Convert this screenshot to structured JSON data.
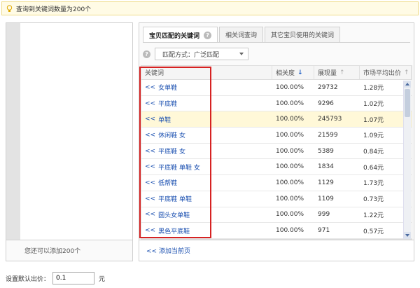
{
  "notice": {
    "text": "查询到关键词数量为200个"
  },
  "left_panel": {
    "footer": "您还可以添加200个"
  },
  "tabs": [
    {
      "label": "宝贝匹配的关键词",
      "active": true
    },
    {
      "label": "相关词查询",
      "active": false
    },
    {
      "label": "其它宝贝使用的关键词",
      "active": false
    }
  ],
  "match": {
    "value": "匹配方式：广泛匹配"
  },
  "table": {
    "headers": {
      "keyword": "关键词",
      "relevance": "相关度",
      "impressions": "展现量",
      "avg_bid": "市场平均出价"
    },
    "rows": [
      {
        "keyword": "女单鞋",
        "relevance": "100.00%",
        "impressions": "29732",
        "avg_bid": "1.28元"
      },
      {
        "keyword": "平底鞋",
        "relevance": "100.00%",
        "impressions": "9296",
        "avg_bid": "1.02元"
      },
      {
        "keyword": "单鞋",
        "relevance": "100.00%",
        "impressions": "245793",
        "avg_bid": "1.07元"
      },
      {
        "keyword": "休闲鞋 女",
        "relevance": "100.00%",
        "impressions": "21599",
        "avg_bid": "1.09元"
      },
      {
        "keyword": "平底鞋 女",
        "relevance": "100.00%",
        "impressions": "5389",
        "avg_bid": "0.84元"
      },
      {
        "keyword": "平底鞋 单鞋 女",
        "relevance": "100.00%",
        "impressions": "1834",
        "avg_bid": "0.64元"
      },
      {
        "keyword": "低帮鞋",
        "relevance": "100.00%",
        "impressions": "1129",
        "avg_bid": "1.73元"
      },
      {
        "keyword": "平底鞋 单鞋",
        "relevance": "100.00%",
        "impressions": "1109",
        "avg_bid": "0.73元"
      },
      {
        "keyword": "圆头女单鞋",
        "relevance": "100.00%",
        "impressions": "999",
        "avg_bid": "1.22元"
      },
      {
        "keyword": "黑色平底鞋",
        "relevance": "100.00%",
        "impressions": "971",
        "avg_bid": "0.57元"
      }
    ],
    "row_prefix": "<<",
    "highlighted_row": 2
  },
  "right_footer": {
    "add_label": "<< 添加当前页"
  },
  "price": {
    "label": "设置默认出价：",
    "value": "0.1",
    "unit": "元"
  },
  "colors": {
    "link": "#1a4fb0",
    "highlight_border": "#d62222",
    "notice_bg": "#fffbe5"
  }
}
